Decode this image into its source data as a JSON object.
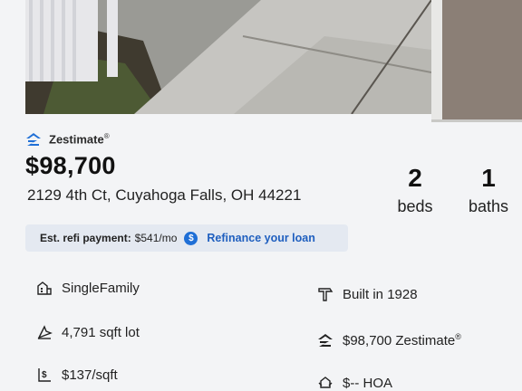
{
  "listing": {
    "zestimate_label": "Zestimate",
    "zestimate_mark": "®",
    "price": "$98,700",
    "address": "2129 4th Ct, Cuyahoga Falls, OH 44221",
    "beds_value": "2",
    "beds_label": "beds",
    "baths_value": "1",
    "baths_label": "baths"
  },
  "refi": {
    "label": "Est. refi payment:",
    "value": "$541/mo",
    "icon_glyph": "$",
    "link": "Refinance your loan"
  },
  "facts": {
    "home_type": "SingleFamily",
    "built": "Built in 1928",
    "lot": "4,791 sqft lot",
    "zestimate": "$98,700 Zestimate",
    "zestimate_mark": "®",
    "price_per_sqft": "$137/sqft",
    "hoa": "$-- HOA"
  },
  "icons": {
    "zestimate": "zillow-logo-icon",
    "home_type": "building-icon",
    "built": "hammer-icon",
    "lot": "lot-size-icon",
    "zestimate_fact": "zillow-logo-icon",
    "price_per_sqft": "price-per-sqft-icon",
    "hoa": "hoa-icon",
    "refi": "dollar-circle-icon"
  },
  "colors": {
    "accent": "#1f6fd6",
    "link": "#1f5fbf",
    "refi_bg": "#e4e9f1"
  }
}
